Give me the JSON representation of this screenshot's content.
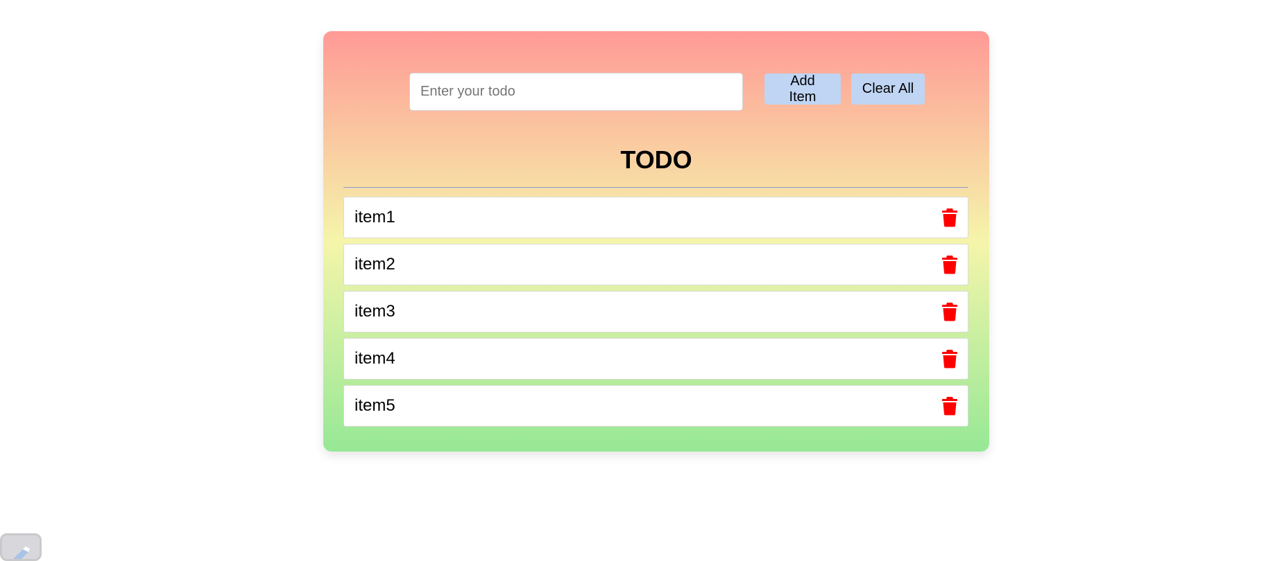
{
  "input": {
    "placeholder": "Enter your todo",
    "value": ""
  },
  "buttons": {
    "add_label": "Add Item",
    "clear_label": "Clear All"
  },
  "heading": "TODO",
  "items": [
    {
      "label": "item1"
    },
    {
      "label": "item2"
    },
    {
      "label": "item3"
    },
    {
      "label": "item4"
    },
    {
      "label": "item5"
    }
  ],
  "icons": {
    "item_action": "trash-icon"
  },
  "colors": {
    "gradient_top": "#ff9a96",
    "gradient_mid": "#f5f5aa",
    "gradient_bottom": "#96e896",
    "button_bg": "#bfd5f3",
    "delete_icon": "#ff0000"
  }
}
